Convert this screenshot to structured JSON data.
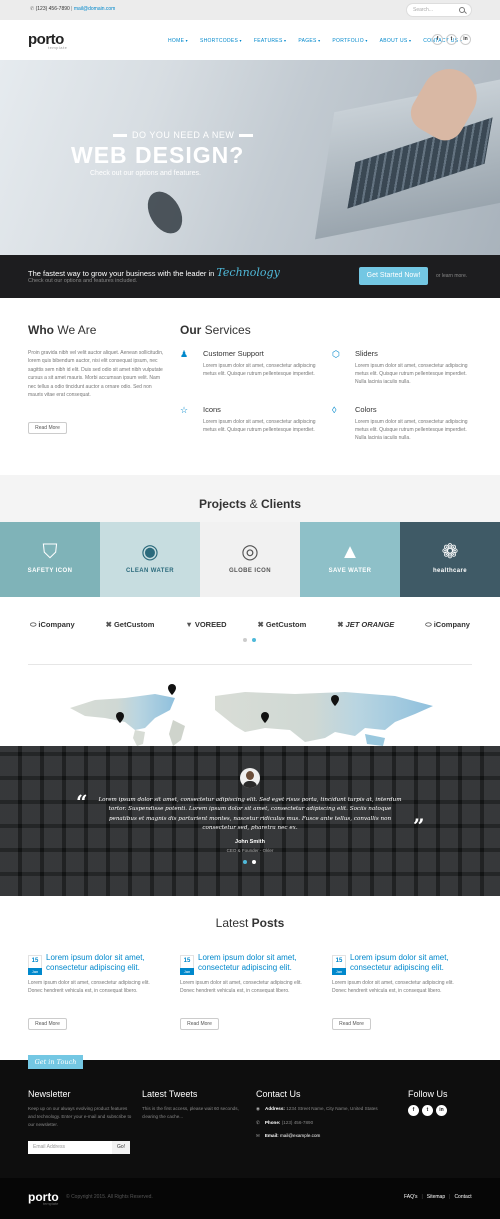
{
  "topbar": {
    "phone": "(123) 456-7890",
    "email": "mail@domain.com",
    "search_placeholder": "Search..."
  },
  "header": {
    "logo": "porto",
    "logo_sub": "template",
    "nav": [
      "HOME",
      "SHORTCODES",
      "FEATURES",
      "PAGES",
      "PORTFOLIO",
      "ABOUT US",
      "CONTACT US"
    ],
    "social": [
      "f",
      "t",
      "in"
    ]
  },
  "hero": {
    "tagline": "DO YOU NEED A NEW",
    "headline": "WEB DESIGN?",
    "sub": "Check out our options and features."
  },
  "callbar": {
    "title": "The fastest way to grow your business with the leader in",
    "title_emph": "Technology",
    "sub": "Check out our options and features included.",
    "cta": "Get Started Now!",
    "or": "or learn more."
  },
  "who": {
    "title_bold": "Who",
    "title_rest": " We Are",
    "text": "Proin gravida nibh vel velit auctor aliquet. Aenean sollicitudin, lorem quis bibendum auctor, nisi elit consequat ipsum, nec sagittis sem nibh id elit. Duis sed odio sit amet nibh vulputate cursus a sit amet mauris. Morbi accumsan ipsum velit. Nam nec tellus a odio tincidunt auctor a ornare odio. Sed non mauris vitae erat consequat.",
    "button": "Read More"
  },
  "services": {
    "title_bold": "Our",
    "title_rest": " Services",
    "items": [
      {
        "icon": "user-icon",
        "glyph": "♟",
        "title": "Customer Support",
        "desc": "Lorem ipsum dolor sit amet, consectetur adipiscing metus elit. Quisque rutrum pellentesque imperdiet."
      },
      {
        "icon": "layers-icon",
        "glyph": "⬡",
        "title": "Sliders",
        "desc": "Lorem ipsum dolor sit amet, consectetur adipiscing metus elit. Quisque rutrum pellentesque imperdiet. Nulla lacinia iaculis nulla."
      },
      {
        "icon": "star-icon",
        "glyph": "☆",
        "title": "Icons",
        "desc": "Lorem ipsum dolor sit amet, consectetur adipiscing metus elit. Quisque rutrum pellentesque imperdiet."
      },
      {
        "icon": "drop-icon",
        "glyph": "◊",
        "title": "Colors",
        "desc": "Lorem ipsum dolor sit amet, consectetur adipiscing metus elit. Quisque rutrum pellentesque imperdiet. Nulla lacinia iaculis nulla."
      }
    ]
  },
  "projects": {
    "title_bold1": "Projects",
    "amp": " & ",
    "title_bold2": "Clients",
    "tiles": [
      {
        "label": "SAFETY ICON",
        "bg": "#7fb3b8",
        "fg": "#ffffff",
        "glyph": "⛉"
      },
      {
        "label": "CLEAN WATER",
        "bg": "#c7dde0",
        "fg": "#2b6a7c",
        "glyph": "◉"
      },
      {
        "label": "GLOBE ICON",
        "bg": "#f1f1f1",
        "fg": "#555555",
        "glyph": "◎"
      },
      {
        "label": "SAVE WATER",
        "bg": "#8ec0c8",
        "fg": "#ffffff",
        "glyph": "▲"
      },
      {
        "label": "healthcare",
        "bg": "#3f5a66",
        "fg": "#ffffff",
        "glyph": "❁"
      }
    ]
  },
  "clients": [
    {
      "glyph": "⬭",
      "name": "iCompany"
    },
    {
      "glyph": "✖",
      "name": "GetCustom"
    },
    {
      "glyph": "▼",
      "name": "VOREED"
    },
    {
      "glyph": "✖",
      "name": "GetCustom"
    },
    {
      "glyph": "✖",
      "name": "JET ORANGE"
    },
    {
      "glyph": "⬭",
      "name": "iCompany"
    }
  ],
  "testimonial": {
    "quote": "Lorem ipsum dolor sit amet, consectetur adipiscing elit. Sed eget risus porta, tincidunt turpis at, interdum tortor. Suspendisse potenti. Lorem ipsum dolor sit amet, consectetur adipiscing elit. Sociis natoque penatibus et magnis dis parturient montes, nascetur ridiculus mus. Fusce ante tellus, convallis non consectetur sed, pharetra nec ex.",
    "name": "John Smith",
    "role": "CEO & Founder - Okler",
    "open_mark": "“",
    "close_mark": "”"
  },
  "posts": {
    "title_rest": "Latest ",
    "title_bold": "Posts",
    "items": [
      {
        "day": "15",
        "month": "Jan",
        "title": "Lorem ipsum dolor sit amet, consectetur adipiscing elit.",
        "excerpt": "Lorem ipsum dolor sit amet, consectetur adipiscing elit. Donec hendrerit vehicula est, in consequat libero.",
        "button": "Read More"
      },
      {
        "day": "15",
        "month": "Jan",
        "title": "Lorem ipsum dolor sit amet, consectetur adipiscing elit.",
        "excerpt": "Lorem ipsum dolor sit amet, consectetur adipiscing elit. Donec hendrerit vehicula est, in consequat libero.",
        "button": "Read More"
      },
      {
        "day": "15",
        "month": "Jan",
        "title": "Lorem ipsum dolor sit amet, consectetur adipiscing elit.",
        "excerpt": "Lorem ipsum dolor sit amet, consectetur adipiscing elit. Donec hendrerit vehicula est, in consequat libero.",
        "button": "Read More"
      }
    ]
  },
  "footer": {
    "get_in_touch": "Get in Touch",
    "newsletter_title": "Newsletter",
    "newsletter_text": "Keep up on our always evolving product features and technology. Enter your e-mail and subscribe to our newsletter.",
    "email_placeholder": "Email Address",
    "go": "Go!",
    "tweets_title": "Latest Tweets",
    "tweets_text": "This is the first access, please wait 60 seconds, clearing the cache...",
    "contact_title": "Contact Us",
    "address_label": "Address:",
    "address": "1234 Street Name, City Name, United States",
    "phone_label": "Phone:",
    "phone": "(123) 456-7890",
    "email_label": "Email:",
    "email": "mail@example.com",
    "follow_title": "Follow Us",
    "social": [
      "f",
      "t",
      "in"
    ]
  },
  "bottom": {
    "logo": "porto",
    "logo_sub": "template",
    "copyright": "© Copyright 2015. All Rights Reserved.",
    "links": [
      "FAQ's",
      "Sitemap",
      "Contact"
    ]
  },
  "colors": {
    "accent": "#0088cc",
    "cta": "#73c7e3",
    "dark": "#1d1d1f"
  }
}
